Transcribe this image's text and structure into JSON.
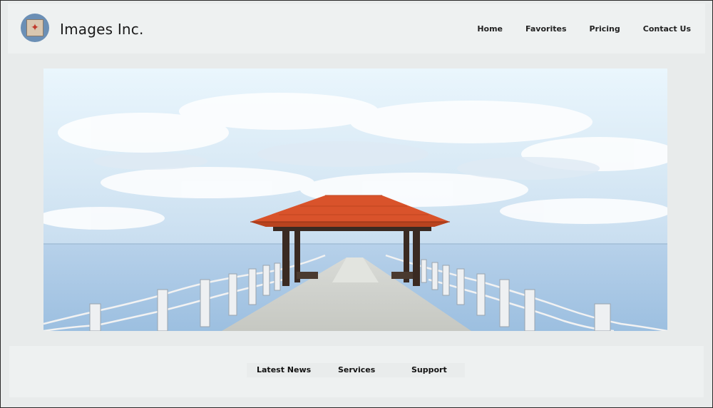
{
  "header": {
    "brand": "Images Inc.",
    "logo_icon": "compass-icon"
  },
  "nav": {
    "items": [
      {
        "label": "Home"
      },
      {
        "label": "Favorites"
      },
      {
        "label": "Pricing"
      },
      {
        "label": "Contact Us"
      }
    ]
  },
  "hero": {
    "image": "pier-gazebo-ocean-photo"
  },
  "footer": {
    "links": [
      {
        "label": "Latest News"
      },
      {
        "label": "Services"
      },
      {
        "label": "Support"
      }
    ]
  },
  "colors": {
    "page_background": "#e9ecec",
    "header_background": "#eef1f1",
    "roof": "#d9532b",
    "sea": "#a9c7e3",
    "sky": "#e7f3fb"
  }
}
